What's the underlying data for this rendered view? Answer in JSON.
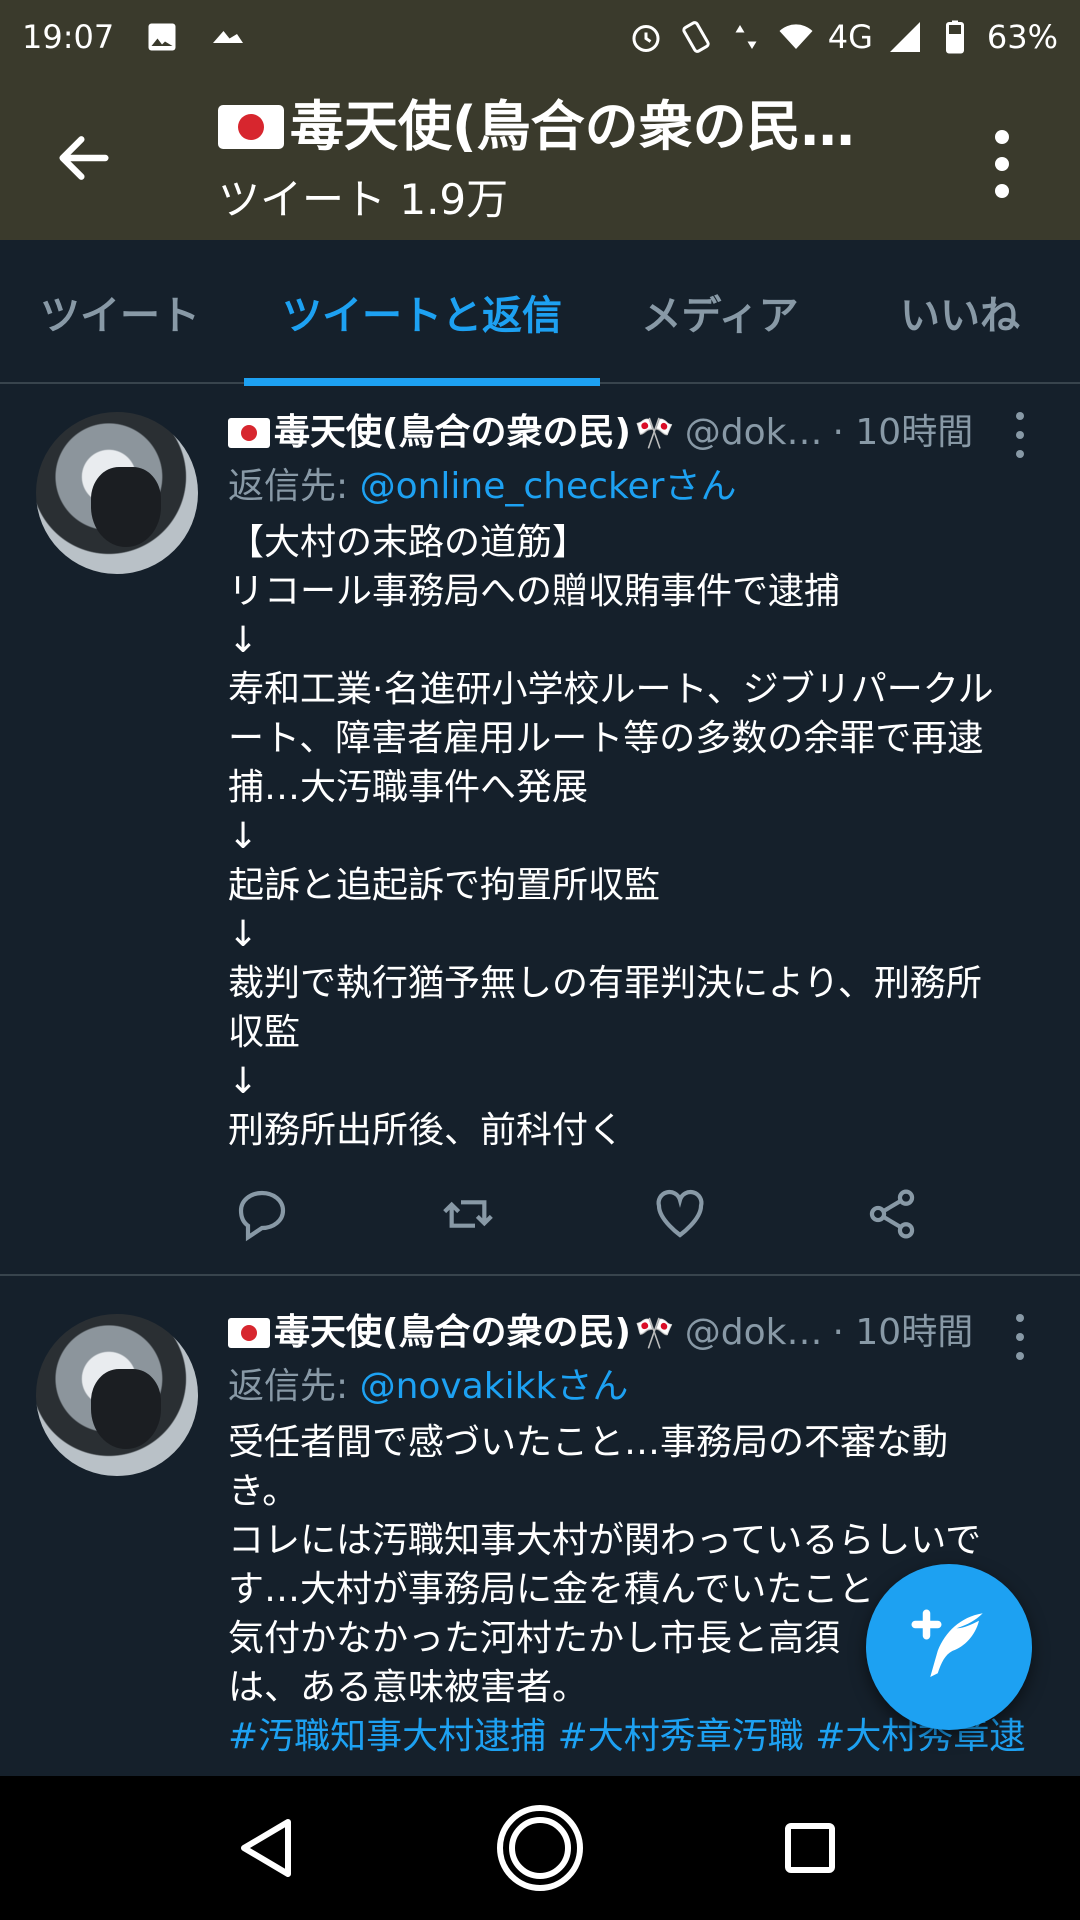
{
  "status_bar": {
    "time": "19:07",
    "battery": "63%",
    "network": "4G"
  },
  "header": {
    "title": "毒天使(鳥合の衆の民…",
    "subtitle": "ツイート 1.9万"
  },
  "tabs": [
    {
      "label": "ツイート",
      "active": false
    },
    {
      "label": "ツイートと返信",
      "active": true
    },
    {
      "label": "メディア",
      "active": false
    },
    {
      "label": "いいね",
      "active": false
    }
  ],
  "tweets": [
    {
      "name": "毒天使(鳥合の衆の民)",
      "handle": "@dok…",
      "time": "· 10時間",
      "reply_prefix": "返信先: ",
      "reply_mention": "@online_checkerさん",
      "lines": [
        "【大村の末路の道筋】",
        "リコール事務局への贈収賄事件で逮捕",
        "↓",
        "寿和工業·名進研小学校ルート、ジブリパークル",
        "ート、障害者雇用ルート等の多数の余罪で再逮",
        "捕…大汚職事件へ発展",
        "↓",
        "起訴と追起訴で拘置所収監",
        "↓",
        "裁判で執行猶予無しの有罪判決により、刑務所",
        "収監",
        "↓",
        "刑務所出所後、前科付く"
      ]
    },
    {
      "name": "毒天使(鳥合の衆の民)",
      "handle": "@dok…",
      "time": "· 10時間",
      "reply_prefix": "返信先: ",
      "reply_mention": "@novakikkさん",
      "lines": [
        "受任者間で感づいたこと…事務局の不審な動",
        "き。",
        "コレには汚職知事大村が関わっているらしいで",
        "す…大村が事務局に金を積んでいたこと",
        "気付かなかった河村たかし市長と高須",
        "は、ある意味被害者。"
      ],
      "hashtags": "#汚職知事大村逮捕 #大村秀章汚職 #大村秀章逮"
    }
  ],
  "colors": {
    "header_bg": "#3a3a2c",
    "page_bg": "#15202b",
    "accent": "#1da1f2",
    "muted": "#8899a6"
  }
}
